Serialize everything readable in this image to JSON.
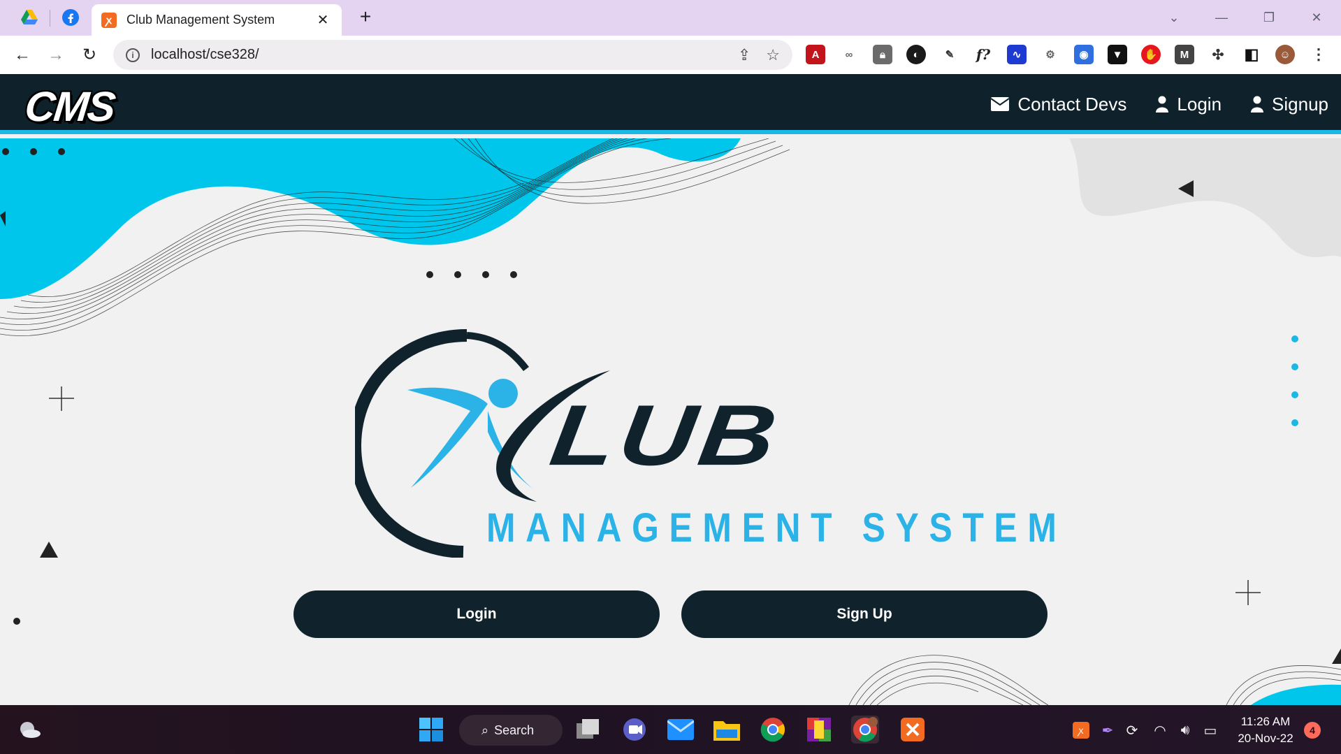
{
  "browser": {
    "tab_title": "Club Management System",
    "close_symbol": "✕",
    "new_tab_symbol": "+",
    "url": "localhost/cse328/",
    "info_symbol": "i"
  },
  "site": {
    "brand": "CMS",
    "nav": [
      {
        "label": "Contact Devs",
        "icon": "envelope-icon"
      },
      {
        "label": "Login",
        "icon": "user-icon"
      },
      {
        "label": "Signup",
        "icon": "user-icon"
      }
    ]
  },
  "hero": {
    "logo_word": "LUB",
    "logo_subtitle": "MANAGEMENT SYSTEM",
    "login_button": "Login",
    "signup_button": "Sign Up"
  },
  "taskbar": {
    "search_label": "Search",
    "time": "11:26 AM",
    "date": "20-Nov-22",
    "notification_count": "4"
  },
  "colors": {
    "header_bg": "#0f212b",
    "accent_cyan": "#1bb8e6",
    "logo_dark": "#10232d",
    "logo_blue": "#2bb3e8"
  }
}
